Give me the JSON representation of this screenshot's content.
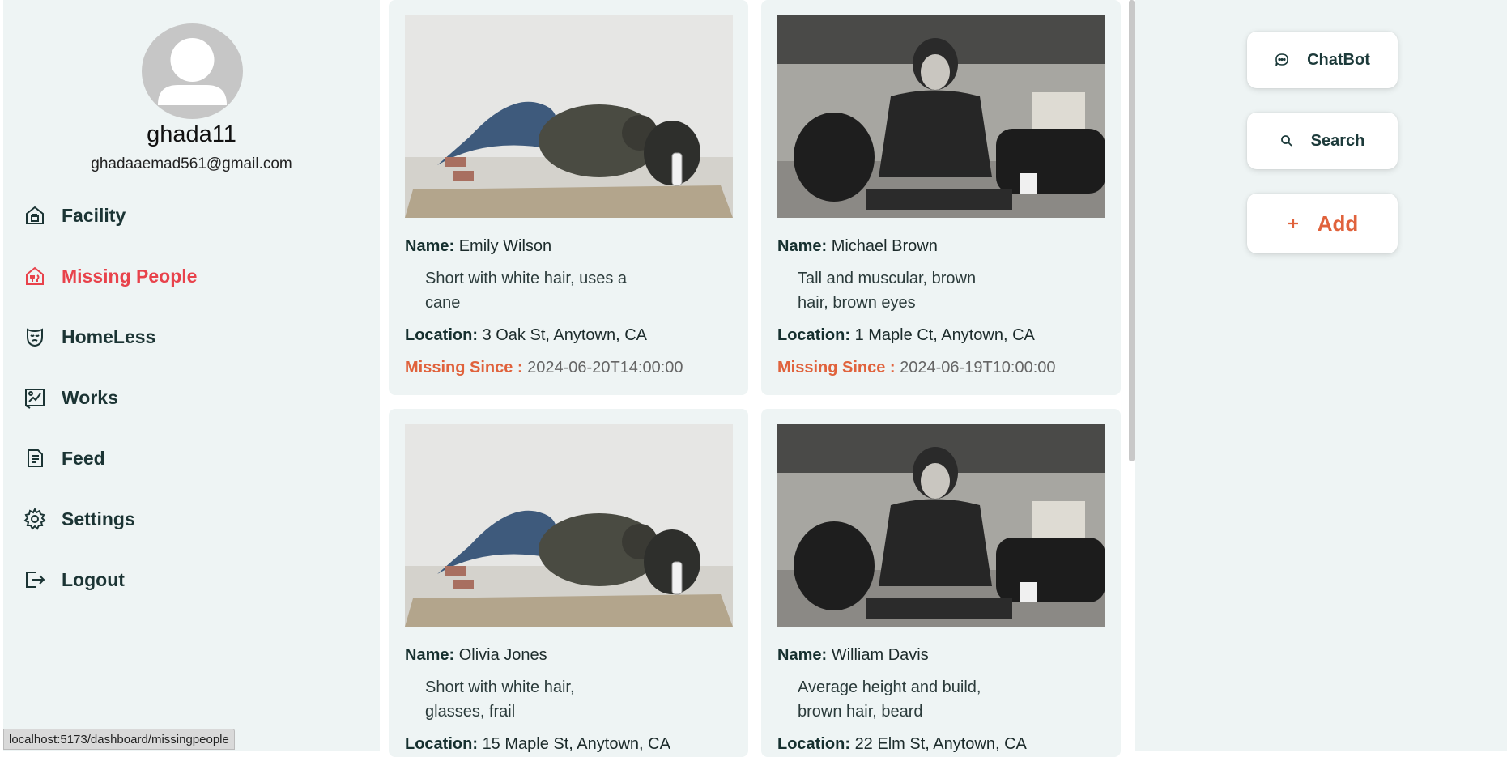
{
  "user": {
    "username": "ghada11",
    "email": "ghadaaemad561@gmail.com"
  },
  "nav": [
    {
      "label": "Facility",
      "icon": "facility-icon",
      "active": false
    },
    {
      "label": "Missing People",
      "icon": "missing-people-icon",
      "active": true
    },
    {
      "label": "HomeLess",
      "icon": "mask-icon",
      "active": false
    },
    {
      "label": "Works",
      "icon": "works-icon",
      "active": false
    },
    {
      "label": "Feed",
      "icon": "feed-icon",
      "active": false
    },
    {
      "label": "Settings",
      "icon": "gear-icon",
      "active": false
    },
    {
      "label": "Logout",
      "icon": "logout-icon",
      "active": false
    }
  ],
  "labels": {
    "name": "Name:",
    "location": "Location:",
    "missing_since": "Missing Since :"
  },
  "cards": [
    {
      "name": "Emily Wilson",
      "desc_line1": "Short with white hair, uses a",
      "desc_line2": "cane",
      "location": "3 Oak St, Anytown, CA",
      "since": "2024-06-20T14:00:00",
      "photo": "person-lying-on-cardboard"
    },
    {
      "name": "Michael Brown",
      "desc_line1": "Tall and muscular, brown",
      "desc_line2": "hair, brown eyes",
      "location": "1 Maple Ct, Anytown, CA",
      "since": "2024-06-19T10:00:00",
      "photo": "young-man-sitting-by-wall"
    },
    {
      "name": "Olivia Jones",
      "desc_line1": "Short with white hair,",
      "desc_line2": "glasses, frail",
      "location": "15 Maple St, Anytown, CA",
      "since": "",
      "photo": "person-lying-on-cardboard"
    },
    {
      "name": "William Davis",
      "desc_line1": "Average height and build,",
      "desc_line2": "brown hair, beard",
      "location": "22 Elm St, Anytown, CA",
      "since": "",
      "photo": "young-man-sitting-by-wall"
    }
  ],
  "actions": {
    "chatbot": "ChatBot",
    "search": "Search",
    "add": "Add"
  },
  "status_url": "localhost:5173/dashboard/missingpeople",
  "colors": {
    "accent": "#e8424b",
    "orange": "#e0623c",
    "panel_bg": "#eef4f4",
    "text_dark": "#1c3a3a"
  }
}
